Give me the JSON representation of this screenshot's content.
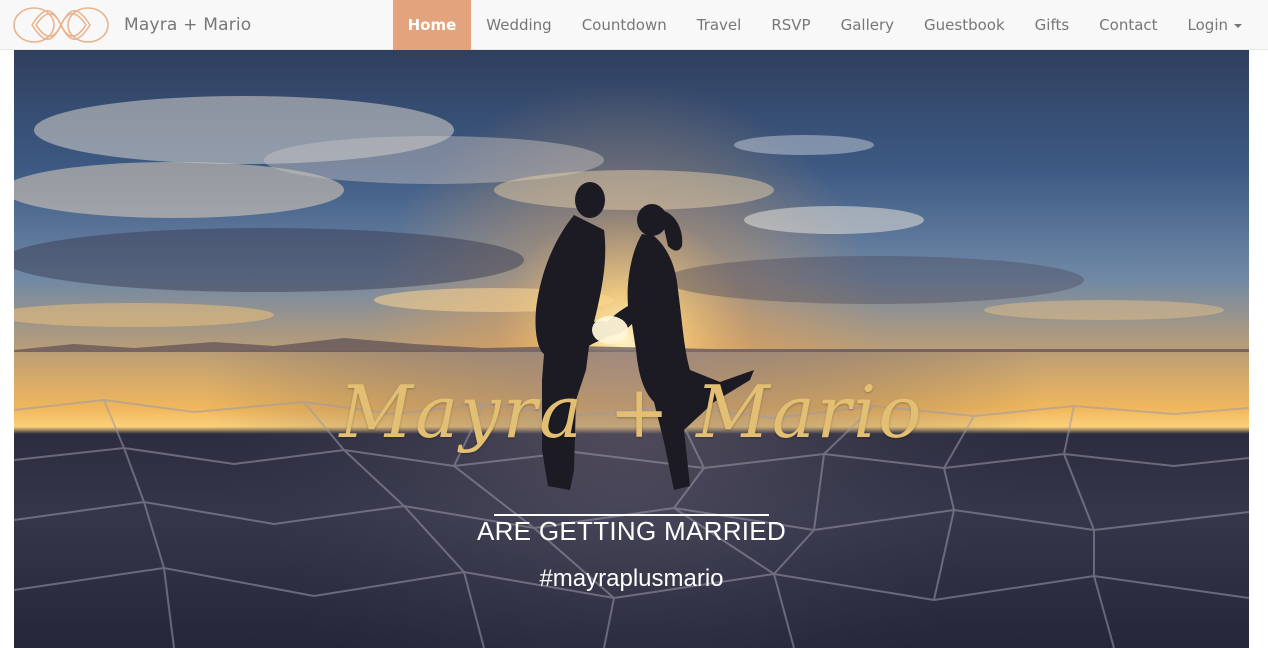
{
  "navbar": {
    "brand_text": "Mayra + Mario",
    "items": [
      {
        "label": "Home",
        "active": true
      },
      {
        "label": "Wedding"
      },
      {
        "label": "Countdown"
      },
      {
        "label": "Travel"
      },
      {
        "label": "RSVP"
      },
      {
        "label": "Gallery"
      },
      {
        "label": "Guestbook"
      },
      {
        "label": "Gifts"
      },
      {
        "label": "Contact"
      },
      {
        "label": "Login"
      }
    ]
  },
  "hero": {
    "title": "Mayra + Mario",
    "subtitle": "ARE GETTING MARRIED",
    "hashtag": "#mayraplusmario"
  },
  "colors": {
    "accent": "#e3a47d",
    "nav_text": "#777777",
    "title_gold": "#e2bf72"
  }
}
